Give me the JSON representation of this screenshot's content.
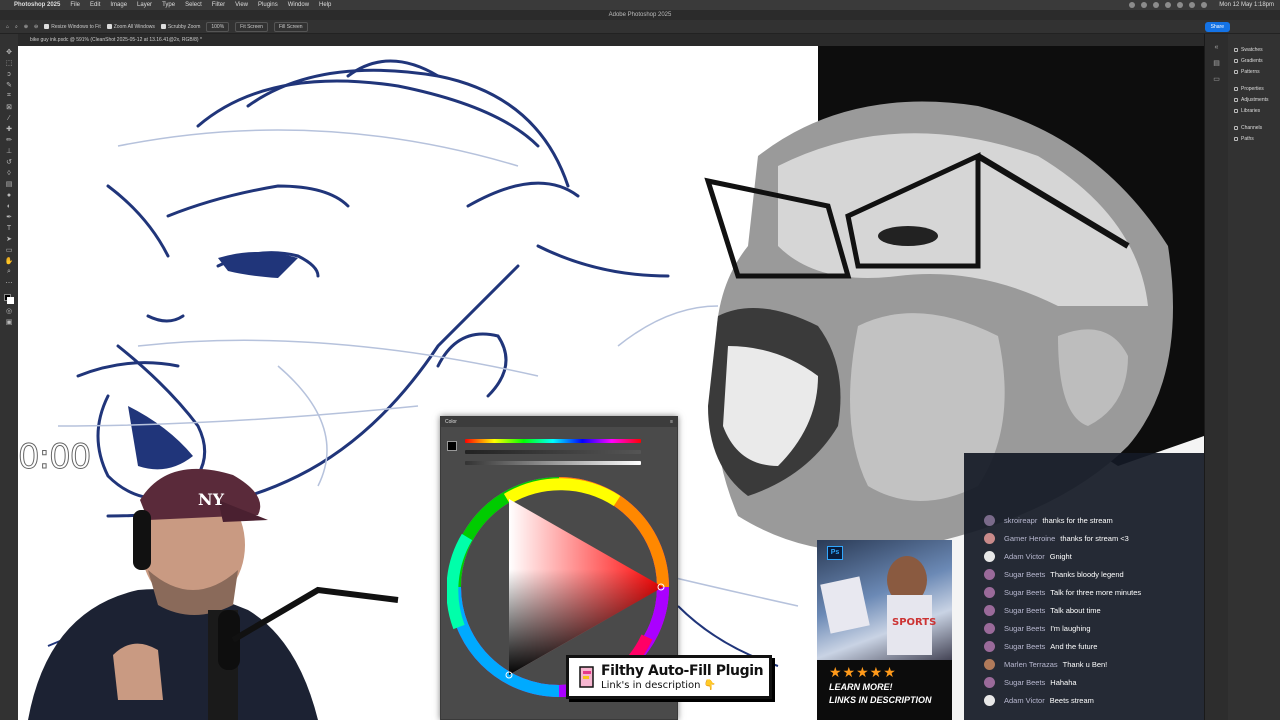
{
  "menubar": {
    "app": "Photoshop 2025",
    "items": [
      "File",
      "Edit",
      "Image",
      "Layer",
      "Type",
      "Select",
      "Filter",
      "View",
      "Plugins",
      "Window",
      "Help"
    ],
    "clock": "Mon 12 May 1:18pm"
  },
  "window_title": "Adobe Photoshop 2025",
  "options": {
    "resize_windows": "Resize Windows to Fit",
    "zoom_all": "Zoom All Windows",
    "scrubby_zoom": "Scrubby Zoom",
    "zoom_pct": "100%",
    "fit_screen": "Fit Screen",
    "fill_screen": "Fill Screen",
    "share": "Share"
  },
  "document_tab": "bike guy ink.psdc @ 591% (CleanShot 2025-05-12 at 13.16.41@2x, RGB/8) *",
  "panels": {
    "group1": [
      "Swatches",
      "Gradients",
      "Patterns"
    ],
    "group2": [
      "Properties",
      "Adjustments",
      "Libraries"
    ],
    "group3": [
      "Channels",
      "Paths"
    ]
  },
  "timer": "0:00",
  "color_panel": {
    "title": "Color"
  },
  "plugin": {
    "title": "Filthy Auto-Fill Plugin",
    "subtitle": "Link's in description 👇"
  },
  "ad": {
    "ps_badge": "Ps",
    "stars": "★★★★★",
    "line1": "LEARN MORE!",
    "line2": "LINKS IN DESCRIPTION"
  },
  "chat": [
    {
      "user": "skroireapr",
      "text": "thanks for the stream",
      "color": "#7a6a8a"
    },
    {
      "user": "Gamer Heroine",
      "text": "thanks for stream <3",
      "color": "#c98a8a"
    },
    {
      "user": "Adam Victor",
      "text": "Gnight",
      "color": "#e8e8e8"
    },
    {
      "user": "Sugar Beets",
      "text": "Thanks bloody legend",
      "color": "#9a6a9a"
    },
    {
      "user": "Sugar Beets",
      "text": "Talk for three more minutes",
      "color": "#9a6a9a"
    },
    {
      "user": "Sugar Beets",
      "text": "Talk about time",
      "color": "#9a6a9a"
    },
    {
      "user": "Sugar Beets",
      "text": "I'm laughing",
      "color": "#9a6a9a"
    },
    {
      "user": "Sugar Beets",
      "text": "And the future",
      "color": "#9a6a9a"
    },
    {
      "user": "Marlen Terrazas",
      "text": "Thank u Ben!",
      "color": "#b07a5a"
    },
    {
      "user": "Sugar Beets",
      "text": "Hahaha",
      "color": "#9a6a9a"
    },
    {
      "user": "Adam Victor",
      "text": "Beets stream",
      "color": "#e8e8e8"
    }
  ]
}
